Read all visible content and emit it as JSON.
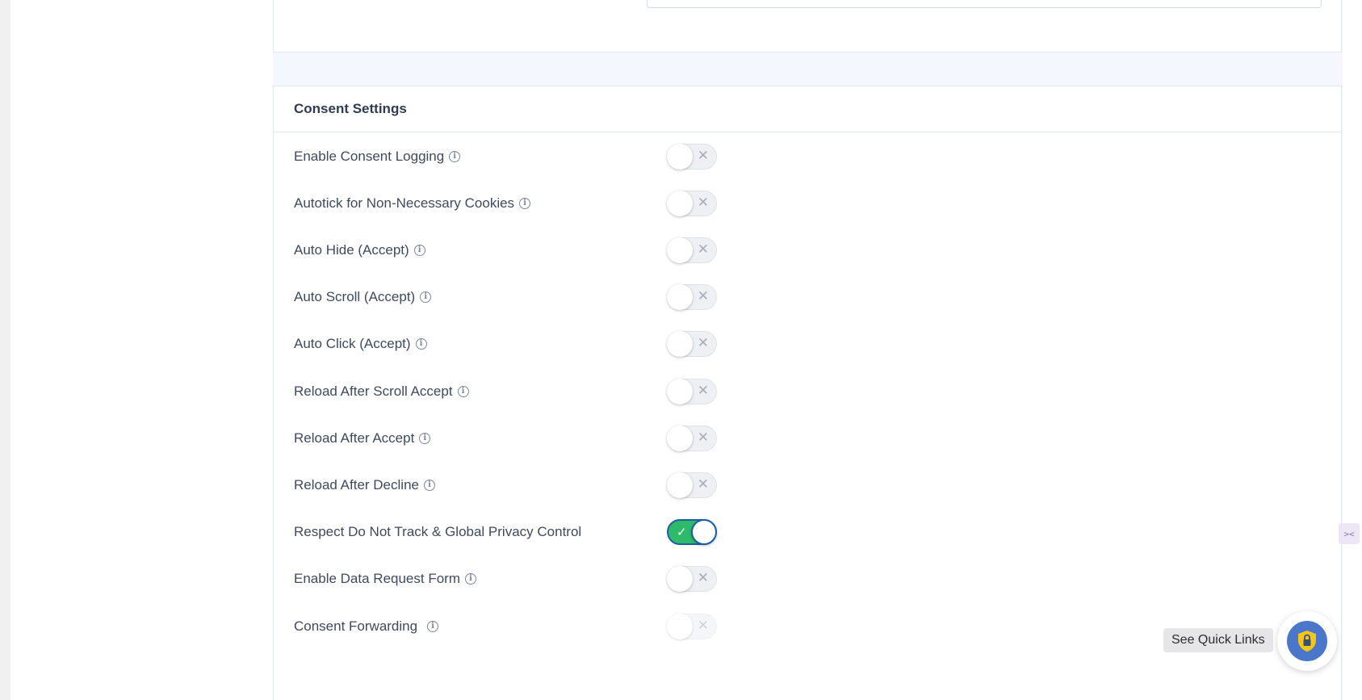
{
  "section": {
    "title": "Consent Settings"
  },
  "settings": [
    {
      "label": "Enable Consent Logging",
      "info": true,
      "enabled": false
    },
    {
      "label": "Autotick for Non-Necessary Cookies",
      "info": true,
      "enabled": false
    },
    {
      "label": "Auto Hide (Accept)",
      "info": true,
      "enabled": false
    },
    {
      "label": "Auto Scroll (Accept)",
      "info": true,
      "enabled": false
    },
    {
      "label": "Auto Click (Accept)",
      "info": true,
      "enabled": false
    },
    {
      "label": "Reload After Scroll Accept",
      "info": true,
      "enabled": false
    },
    {
      "label": "Reload After Accept",
      "info": true,
      "enabled": false
    },
    {
      "label": "Reload After Decline",
      "info": true,
      "enabled": false
    },
    {
      "label": "Respect Do Not Track & Global Privacy Control",
      "info": false,
      "enabled": true
    },
    {
      "label": "Enable Data Request Form",
      "info": true,
      "enabled": false
    },
    {
      "label": "Consent Forwarding",
      "info": true,
      "enabled": false
    }
  ],
  "quick_links": {
    "label": "See Quick Links"
  },
  "colors": {
    "toggle_on": "#2ebb69",
    "toggle_on_border": "#1c5fa8",
    "toggle_off": "#eef0f3",
    "quick_links_badge": "#4a77c9"
  },
  "icons": {
    "info": "info-circle-icon",
    "lock": "lock-shield-icon",
    "check": "check-icon",
    "cross": "x-icon"
  }
}
